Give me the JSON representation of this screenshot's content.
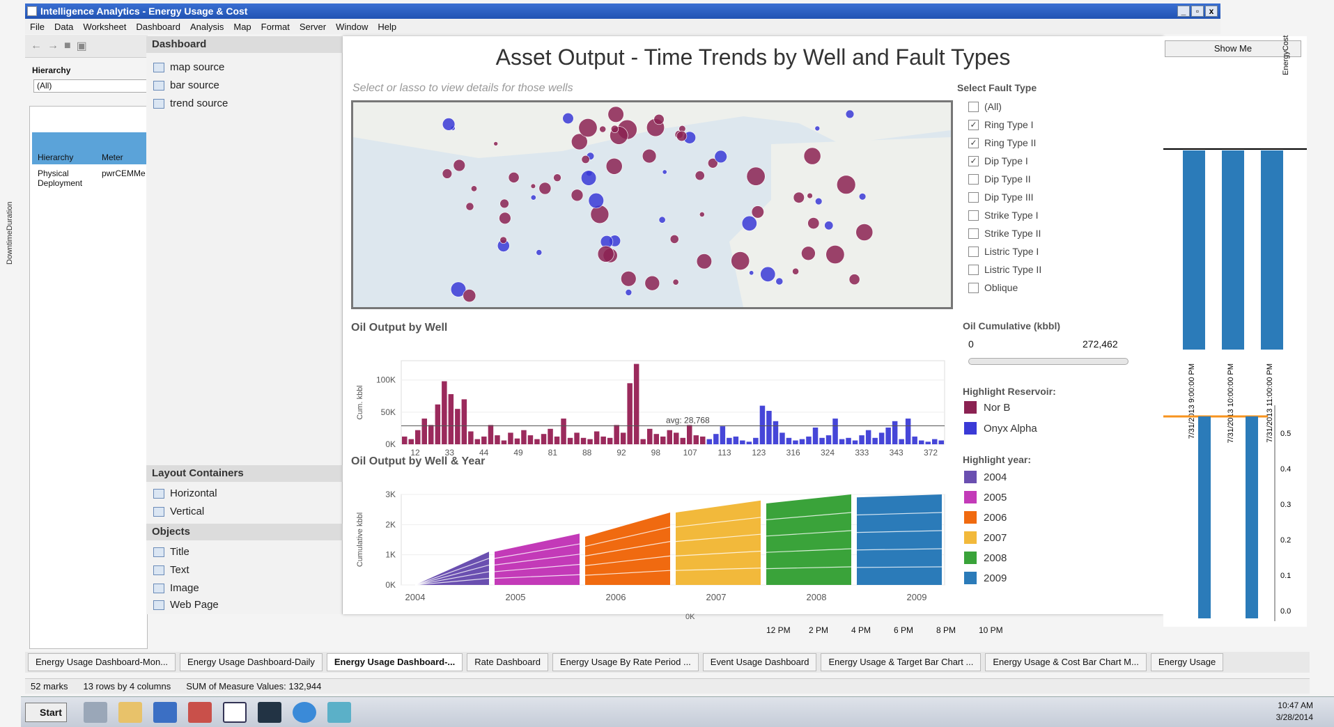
{
  "window": {
    "title": "Intelligence Analytics - Energy Usage & Cost",
    "buttons": [
      "_",
      "▫",
      "x"
    ]
  },
  "menu": [
    "File",
    "Data",
    "Worksheet",
    "Dashboard",
    "Analysis",
    "Map",
    "Format",
    "Server",
    "Window",
    "Help"
  ],
  "left": {
    "hierarchy_label": "Hierarchy",
    "hierarchy_value": "(All)",
    "col_hierarchy": "Hierarchy",
    "col_meter": "Meter",
    "row_hierarchy": "Physical Deployment",
    "row_meter": "pwrCEMMe",
    "side_axis": "DowntimeDuration"
  },
  "side": {
    "header": "Dashboard",
    "items": [
      "map source",
      "bar source",
      "trend source"
    ],
    "layout_header": "Layout Containers",
    "layout_items": [
      "Horizontal",
      "Vertical"
    ],
    "objects_header": "Objects",
    "objects_items": [
      "Title",
      "Text",
      "Image",
      "Web Page"
    ]
  },
  "dashboard": {
    "title": "Asset Output - Time Trends by Well and Fault Types",
    "map_hint": "Select or lasso to view details for those wells",
    "fault": {
      "title": "Select Fault Type",
      "items": [
        {
          "label": "(All)",
          "checked": false
        },
        {
          "label": "Ring Type I",
          "checked": true
        },
        {
          "label": "Ring Type II",
          "checked": true
        },
        {
          "label": "Dip Type I",
          "checked": true
        },
        {
          "label": "Dip Type II",
          "checked": false
        },
        {
          "label": "Dip Type III",
          "checked": false
        },
        {
          "label": "Strike Type I",
          "checked": false
        },
        {
          "label": "Strike Type II",
          "checked": false
        },
        {
          "label": "Listric Type I",
          "checked": false
        },
        {
          "label": "Listric Type II",
          "checked": false
        },
        {
          "label": "Oblique",
          "checked": false
        }
      ]
    },
    "bar_title": "Oil Output by Well",
    "area_title": "Oil Output by Well & Year",
    "cumulative": {
      "title": "Oil Cumulative (kbbl)",
      "min": "0",
      "max": "272,462"
    },
    "reservoir": {
      "title": "Highlight Reservoir:",
      "items": [
        {
          "label": "Nor B",
          "color": "#8b2252"
        },
        {
          "label": "Onyx Alpha",
          "color": "#3a3ad6"
        }
      ]
    },
    "year": {
      "title": "Highlight year:",
      "items": [
        {
          "label": "2004",
          "color": "#6a4fb0"
        },
        {
          "label": "2005",
          "color": "#c33ab8"
        },
        {
          "label": "2006",
          "color": "#f06a10"
        },
        {
          "label": "2007",
          "color": "#f2b93b"
        },
        {
          "label": "2008",
          "color": "#3aa33a"
        },
        {
          "label": "2009",
          "color": "#2b7bb9"
        }
      ]
    }
  },
  "chart_data": [
    {
      "type": "bar",
      "title": "Oil Output by Well",
      "ylabel": "Cum. kbbl",
      "ylim": [
        0,
        130
      ],
      "yticks": [
        "0K",
        "50K",
        "100K"
      ],
      "categories": [
        "12",
        "33",
        "44",
        "49",
        "81",
        "88",
        "92",
        "98",
        "107",
        "113",
        "123",
        "316",
        "324",
        "333",
        "343",
        "372"
      ],
      "avg_label": "avg: 28,768",
      "values": [
        12,
        8,
        22,
        40,
        30,
        62,
        98,
        78,
        55,
        70,
        20,
        8,
        12,
        30,
        14,
        6,
        18,
        9,
        22,
        14,
        8,
        16,
        24,
        12,
        40,
        10,
        18,
        10,
        8,
        20,
        12,
        10,
        30,
        18,
        95,
        125,
        8,
        24,
        16,
        12,
        22,
        18,
        10,
        30,
        14,
        12,
        8,
        16,
        28,
        10,
        12,
        6,
        4,
        10,
        60,
        52,
        36,
        18,
        10,
        6,
        8,
        12,
        26,
        10,
        14,
        40,
        8,
        10,
        6,
        14,
        22,
        10,
        18,
        26,
        36,
        8,
        40,
        12,
        6,
        4,
        8,
        6
      ]
    },
    {
      "type": "area",
      "title": "Oil Output by Well & Year",
      "ylabel": "Cumulative kbbl",
      "ylim": [
        0,
        3
      ],
      "yticks": [
        "0K",
        "1K",
        "2K",
        "3K"
      ],
      "categories": [
        "2004",
        "2005",
        "2006",
        "2007",
        "2008",
        "2009"
      ],
      "series": [
        {
          "name": "2004",
          "values": [
            0,
            1.1
          ]
        },
        {
          "name": "2005",
          "values": [
            1.1,
            1.7
          ]
        },
        {
          "name": "2006",
          "values": [
            1.6,
            2.4
          ]
        },
        {
          "name": "2007",
          "values": [
            2.4,
            2.8
          ]
        },
        {
          "name": "2008",
          "values": [
            2.7,
            3.0
          ]
        },
        {
          "name": "2009",
          "values": [
            2.9,
            3.0
          ]
        }
      ]
    },
    {
      "type": "scatter",
      "title": "",
      "points": [
        {
          "x": 0.55,
          "y": 0.4,
          "c": "r",
          "s": 14
        },
        {
          "x": 0.62,
          "y": 0.2,
          "c": "r",
          "s": 11
        },
        {
          "x": 0.95,
          "y": 0.45,
          "c": "b",
          "s": 8
        }
      ]
    }
  ],
  "right": {
    "show_me": "Show Me",
    "dates": [
      "7/31/2013 9:00:00 PM",
      "7/31/2013 10:00:00 PM",
      "7/31/2013 11:00:00 PM"
    ],
    "yticks": [
      "0.5",
      "0.4",
      "0.3",
      "0.2",
      "0.1",
      "0.0"
    ],
    "ylabel": "EnergyCost",
    "xticks": [
      "12 PM",
      "2 PM",
      "4 PM",
      "6 PM",
      "8 PM",
      "10 PM"
    ],
    "zero": "0K"
  },
  "tabs": [
    {
      "label": "Energy Usage Dashboard-Mon...",
      "active": false
    },
    {
      "label": "Energy Usage Dashboard-Daily",
      "active": false
    },
    {
      "label": "Energy Usage Dashboard-...",
      "active": true
    },
    {
      "label": "Rate Dashboard",
      "active": false
    },
    {
      "label": "Energy Usage By Rate Period ...",
      "active": false
    },
    {
      "label": "Event Usage Dashboard",
      "active": false
    },
    {
      "label": "Energy Usage & Target Bar Chart ...",
      "active": false
    },
    {
      "label": "Energy Usage & Cost Bar Chart M...",
      "active": false
    },
    {
      "label": "Energy Usage",
      "active": false
    }
  ],
  "status": {
    "marks": "52 marks",
    "rows": "13 rows by 4 columns",
    "sum": "SUM of Measure Values: 132,944"
  },
  "taskbar": {
    "start": "Start",
    "time": "10:47 AM",
    "date": "3/28/2014"
  }
}
